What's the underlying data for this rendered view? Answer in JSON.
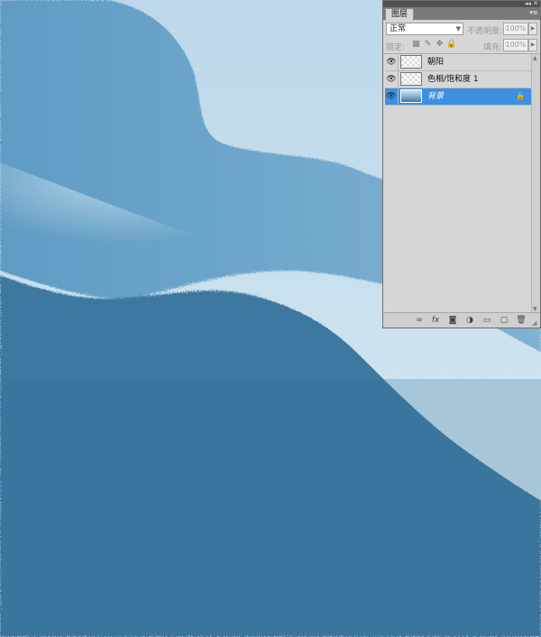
{
  "panel": {
    "tab_label": "图层",
    "blend_mode": "正常",
    "opacity_label": "不透明度:",
    "opacity_value": "100%",
    "lock_label": "锁定:",
    "fill_label": "填充:",
    "fill_value": "100%"
  },
  "layers": [
    {
      "name": "朝阳",
      "selected": false
    },
    {
      "name": "色相/饱和度 1",
      "selected": false
    },
    {
      "name": "背景",
      "selected": true
    }
  ],
  "icons": {
    "eye": "👁",
    "lock": "🔒",
    "link": "∞",
    "fx": "fx",
    "mask": "◙",
    "adjust": "◑",
    "group": "▭",
    "new": "▢",
    "trash": "🗑"
  },
  "colors": {
    "canvas_light": "#cfe3ef",
    "canvas_mid": "#6fa3c8",
    "canvas_dark": "#3a76a0",
    "selection": "#3d8fe0"
  }
}
